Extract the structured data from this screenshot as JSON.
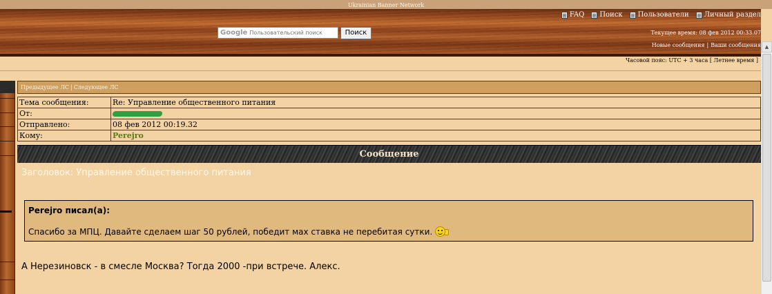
{
  "top_strip": {
    "title": "Ukrainian Banner Network"
  },
  "search": {
    "logo": "Google",
    "placeholder": "Пользовательский поиск",
    "button_label": "Поиск"
  },
  "topnav": {
    "items": [
      {
        "label": "FAQ",
        "icon": "faq-icon"
      },
      {
        "label": "Поиск",
        "icon": "search-icon"
      },
      {
        "label": "Пользователи",
        "icon": "users-icon"
      },
      {
        "label": "Личный раздел",
        "icon": "profile-icon"
      }
    ]
  },
  "header": {
    "current_time": "Текущее время: 08 фев 2012 00:33.07",
    "new_messages": "Новые сообщения",
    "separator": "|",
    "your_messages": "Ваши сообщения"
  },
  "timezone": {
    "text": "Часовой пояс: UTC + 3 часа [ Летнее время ]"
  },
  "pm_nav": {
    "prev": "Предыдущее ЛС",
    "separator": "|",
    "next": "Следующее ЛС"
  },
  "pm_info": {
    "subject_label": "Тема сообщения:",
    "subject_value": "Re: Управление общественного питания",
    "from_label": "От:",
    "sent_label": "Отправлено:",
    "sent_value": "08 фев 2012 00:19.32",
    "to_label": "Кому:",
    "to_value": "Perejro"
  },
  "message": {
    "header": "Сообщение",
    "subject": "Заголовок: Управление общественного питания",
    "quote_author": "Perejro писал(а):",
    "quote_text": "Спасибо за МПЦ. Давайте сделаем шаг 50 рублей, победит мах ставка не перебитая сутки.",
    "reply": "А Нерезиновск - в смесле Москва? Тогда 2000 -при встрече. Алекс."
  },
  "colors": {
    "page_bg": "#f3d3a3",
    "quote_bg": "#e0b97e",
    "recipient": "#5b7a17",
    "redaction": "#2ea043"
  }
}
